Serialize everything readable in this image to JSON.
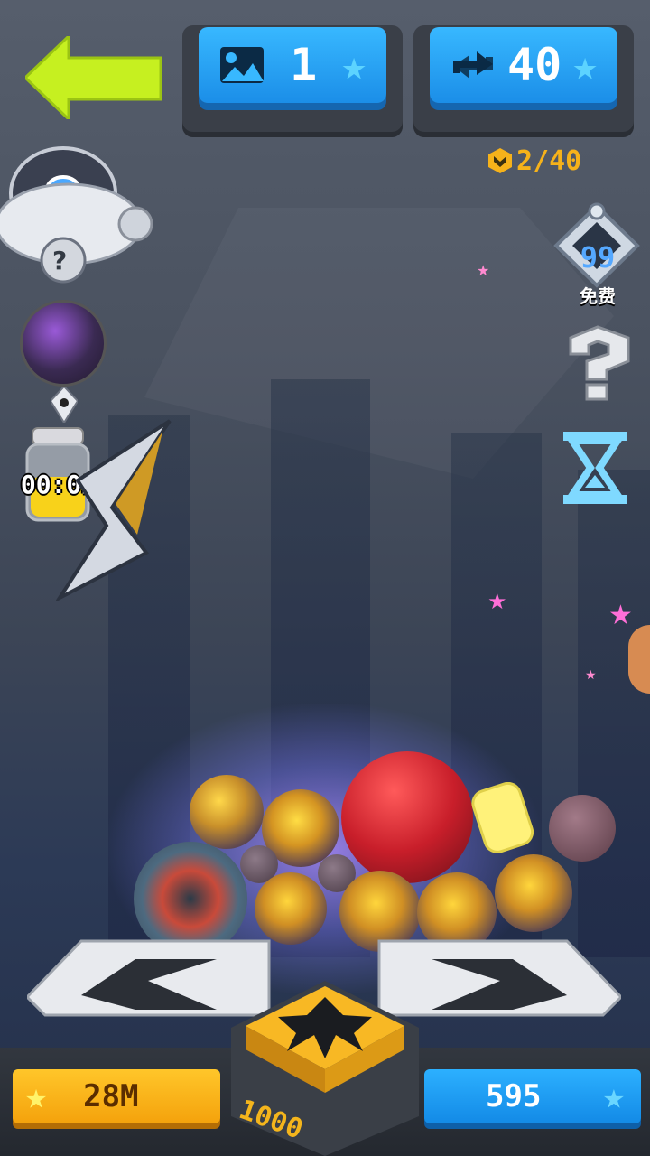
{
  "header": {
    "level_value": "1",
    "moves_value": "40",
    "progress_text": "2/40"
  },
  "side": {
    "badge_number": "99",
    "badge_label": "免费"
  },
  "dispenser": {
    "timer": "00:02"
  },
  "footer": {
    "coins": "28M",
    "stars": "595",
    "launch_cost": "1000"
  },
  "colors": {
    "accent_blue": "#1b8ee8",
    "accent_gold": "#f4a20c",
    "back_arrow": "#c6f020"
  },
  "icons": {
    "back": "arrow-left-icon",
    "level": "landscape-icon",
    "moves": "refresh-icon",
    "star": "star-icon",
    "mystery": "question-icon",
    "timer": "hourglass-icon",
    "launch": "claw-icon"
  }
}
